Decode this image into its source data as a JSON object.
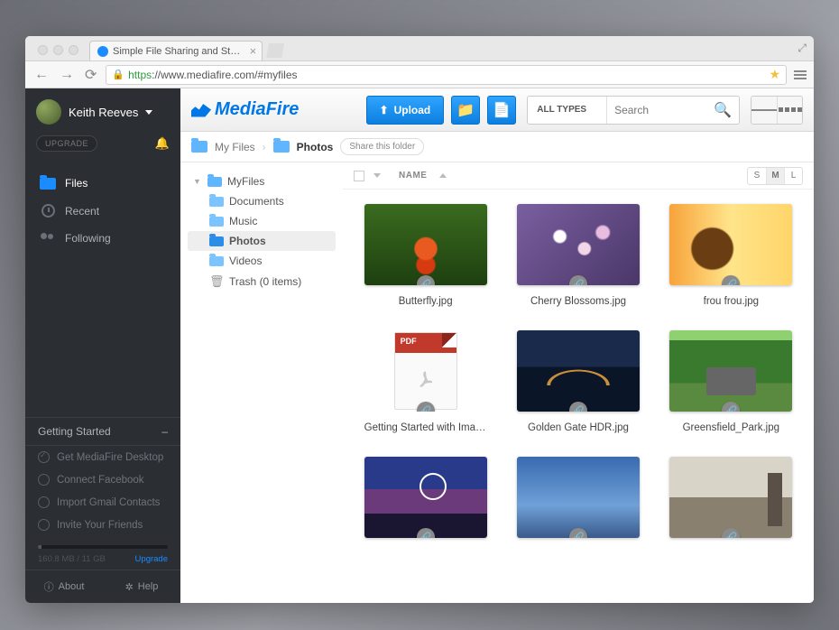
{
  "browser": {
    "tab_title": "Simple File Sharing and St…",
    "url_protocol": "https",
    "url_host": "://www.mediafire.com",
    "url_path": "/#myfiles"
  },
  "user": {
    "name": "Keith Reeves"
  },
  "sidebar": {
    "upgrade_label": "UPGRADE",
    "nav": [
      {
        "label": "Files",
        "active": true
      },
      {
        "label": "Recent",
        "active": false
      },
      {
        "label": "Following",
        "active": false
      }
    ],
    "getting_started": {
      "title": "Getting Started",
      "items": [
        {
          "label": "Get MediaFire Desktop",
          "done": true
        },
        {
          "label": "Connect Facebook",
          "done": false
        },
        {
          "label": "Import Gmail Contacts",
          "done": false
        },
        {
          "label": "Invite Your Friends",
          "done": false
        }
      ]
    },
    "storage": {
      "used": "160.8 MB",
      "sep": " / ",
      "total": "11 GB",
      "upgrade": "Upgrade"
    },
    "footer": {
      "about": "About",
      "help": "Help"
    }
  },
  "topbar": {
    "brand": "MediaFire",
    "upload": "Upload",
    "all_types": "ALL TYPES",
    "search_placeholder": "Search"
  },
  "breadcrumb": {
    "root": "My Files",
    "current": "Photos",
    "share": "Share this folder"
  },
  "tree": {
    "root": "MyFiles",
    "children": [
      "Documents",
      "Music",
      "Photos",
      "Videos"
    ],
    "selected": "Photos",
    "trash": "Trash (0 items)"
  },
  "grid_header": {
    "name": "NAME",
    "sizes": [
      "S",
      "M",
      "L"
    ],
    "active_size": "M"
  },
  "files": [
    {
      "name": "Butterfly.jpg",
      "thumb": "t-butterfly"
    },
    {
      "name": "Cherry Blossoms.jpg",
      "thumb": "t-cherry"
    },
    {
      "name": "frou frou.jpg",
      "thumb": "t-frou"
    },
    {
      "name": "Getting Started with Imag…",
      "thumb": "t-pdf",
      "pdf": true
    },
    {
      "name": "Golden Gate HDR.jpg",
      "thumb": "t-gg"
    },
    {
      "name": "Greensfield_Park.jpg",
      "thumb": "t-green"
    },
    {
      "name": "",
      "thumb": "t-pier"
    },
    {
      "name": "",
      "thumb": "t-sky"
    },
    {
      "name": "",
      "thumb": "t-city"
    }
  ]
}
